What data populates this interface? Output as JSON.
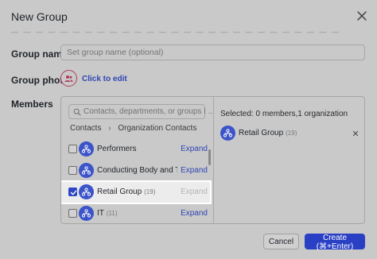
{
  "dialog": {
    "title": "New Group",
    "close_icon": "close-icon",
    "hidden_hint": "— — — — — — — — — — — — — — — — — — — — — — — — — — —"
  },
  "group_name": {
    "label": "Group name",
    "placeholder": "Set group name (optional)",
    "value": ""
  },
  "group_photo": {
    "label": "Group photo",
    "icon": "users-icon",
    "action_label": "Click to edit"
  },
  "members": {
    "label": "Members",
    "search_placeholder": "Contacts, departments, or groups I ...",
    "breadcrumb": [
      "Contacts",
      "Organization Contacts"
    ],
    "list": [
      {
        "name": "Performers",
        "count": "",
        "checked": false,
        "expand_label": "Expand",
        "expand_enabled": true
      },
      {
        "name": "Conducting Body and Trai...",
        "count": "",
        "checked": false,
        "expand_label": "Expand",
        "expand_enabled": true
      },
      {
        "name": "Retail Group",
        "count": "(19)",
        "checked": true,
        "expand_label": "Expand",
        "expand_enabled": false
      },
      {
        "name": "IT",
        "count": "(11)",
        "checked": false,
        "expand_label": "Expand",
        "expand_enabled": true
      }
    ],
    "selected_summary": "Selected: 0 members,1 organization",
    "selected": [
      {
        "name": "Retail Group",
        "count": "(19)"
      }
    ]
  },
  "footer": {
    "cancel_label": "Cancel",
    "create_label": "Create (⌘+Enter)"
  },
  "colors": {
    "accent": "#2940c4",
    "avatar": "#3b54c9",
    "photo_ring": "#b13b5c",
    "overlay_bg": "#c9c9c9"
  }
}
